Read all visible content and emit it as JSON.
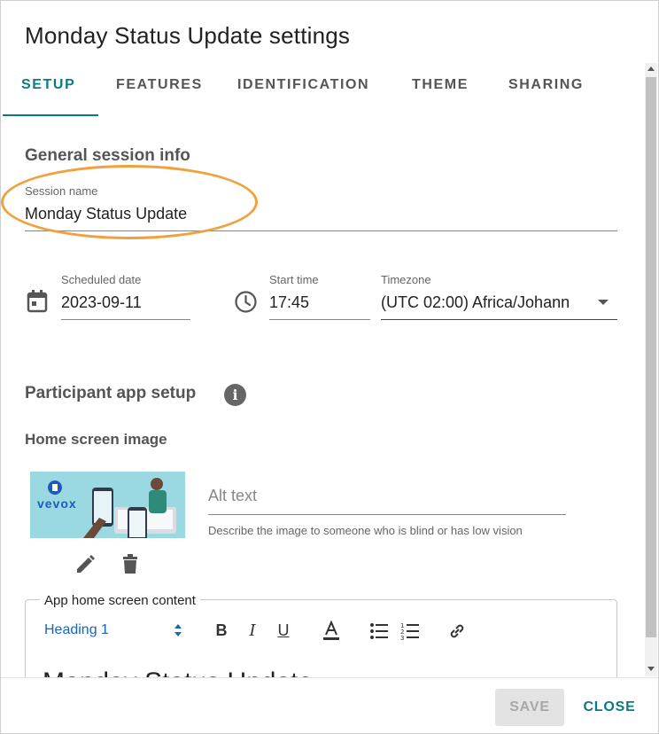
{
  "dialog": {
    "title": "Monday Status Update settings"
  },
  "tabs": [
    {
      "label": "SETUP",
      "active": true
    },
    {
      "label": "FEATURES",
      "active": false
    },
    {
      "label": "IDENTIFICATION",
      "active": false
    },
    {
      "label": "THEME",
      "active": false
    },
    {
      "label": "SHARING",
      "active": false
    }
  ],
  "general": {
    "section_title": "General session info",
    "session_name_label": "Session name",
    "session_name_value": "Monday Status Update",
    "scheduled_date_label": "Scheduled date",
    "scheduled_date_value": "2023-09-11",
    "start_time_label": "Start time",
    "start_time_value": "17:45",
    "timezone_label": "Timezone",
    "timezone_value": "(UTC 02:00) Africa/Johann"
  },
  "participant": {
    "section_title": "Participant app setup",
    "home_image_title": "Home screen image",
    "alt_text_placeholder": "Alt text",
    "alt_text_helper": "Describe the image to someone who is blind or has low vision",
    "image_brand": "vevox"
  },
  "editor": {
    "legend": "App home screen content",
    "format_select": "Heading 1",
    "peek_text": "Monday Status Update"
  },
  "footer": {
    "save_label": "SAVE",
    "close_label": "CLOSE"
  },
  "colors": {
    "accent": "#0a7c80",
    "highlight_ring": "#f0a03c",
    "link_blue": "#1565c0"
  }
}
